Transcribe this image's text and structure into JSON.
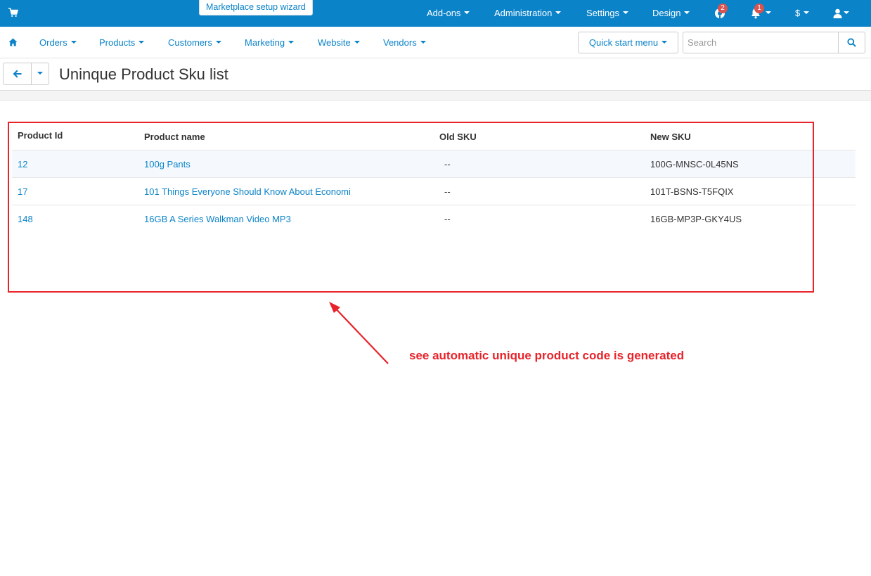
{
  "topbar": {
    "wizard_label": "Marketplace setup wizard",
    "menus": [
      {
        "label": "Add-ons"
      },
      {
        "label": "Administration"
      },
      {
        "label": "Settings"
      },
      {
        "label": "Design"
      }
    ],
    "help_badge": "2",
    "notifications_badge": "1",
    "currency": "$",
    "accent_color": "#0b83c8"
  },
  "navbar": {
    "items": [
      {
        "label": "Orders"
      },
      {
        "label": "Products"
      },
      {
        "label": "Customers"
      },
      {
        "label": "Marketing"
      },
      {
        "label": "Website"
      },
      {
        "label": "Vendors"
      }
    ],
    "quick_start_label": "Quick start menu",
    "search_placeholder": "Search"
  },
  "page": {
    "title": "Uninque Product Sku list"
  },
  "table": {
    "headers": {
      "product_id": "Product Id",
      "product_name": "Product name",
      "old_sku": "Old SKU",
      "new_sku": "New SKU"
    },
    "rows": [
      {
        "product_id": "12",
        "product_name": "100g Pants",
        "old_sku": "--",
        "new_sku": "100G-MNSC-0L45NS"
      },
      {
        "product_id": "17",
        "product_name": "101 Things Everyone Should Know About Economi",
        "old_sku": "--",
        "new_sku": "101T-BSNS-T5FQIX"
      },
      {
        "product_id": "148",
        "product_name": "16GB A Series Walkman Video MP3",
        "old_sku": "--",
        "new_sku": "16GB-MP3P-GKY4US"
      }
    ]
  },
  "annotation": {
    "text": "see automatic unique product code is generated",
    "color": "#e8232a"
  }
}
